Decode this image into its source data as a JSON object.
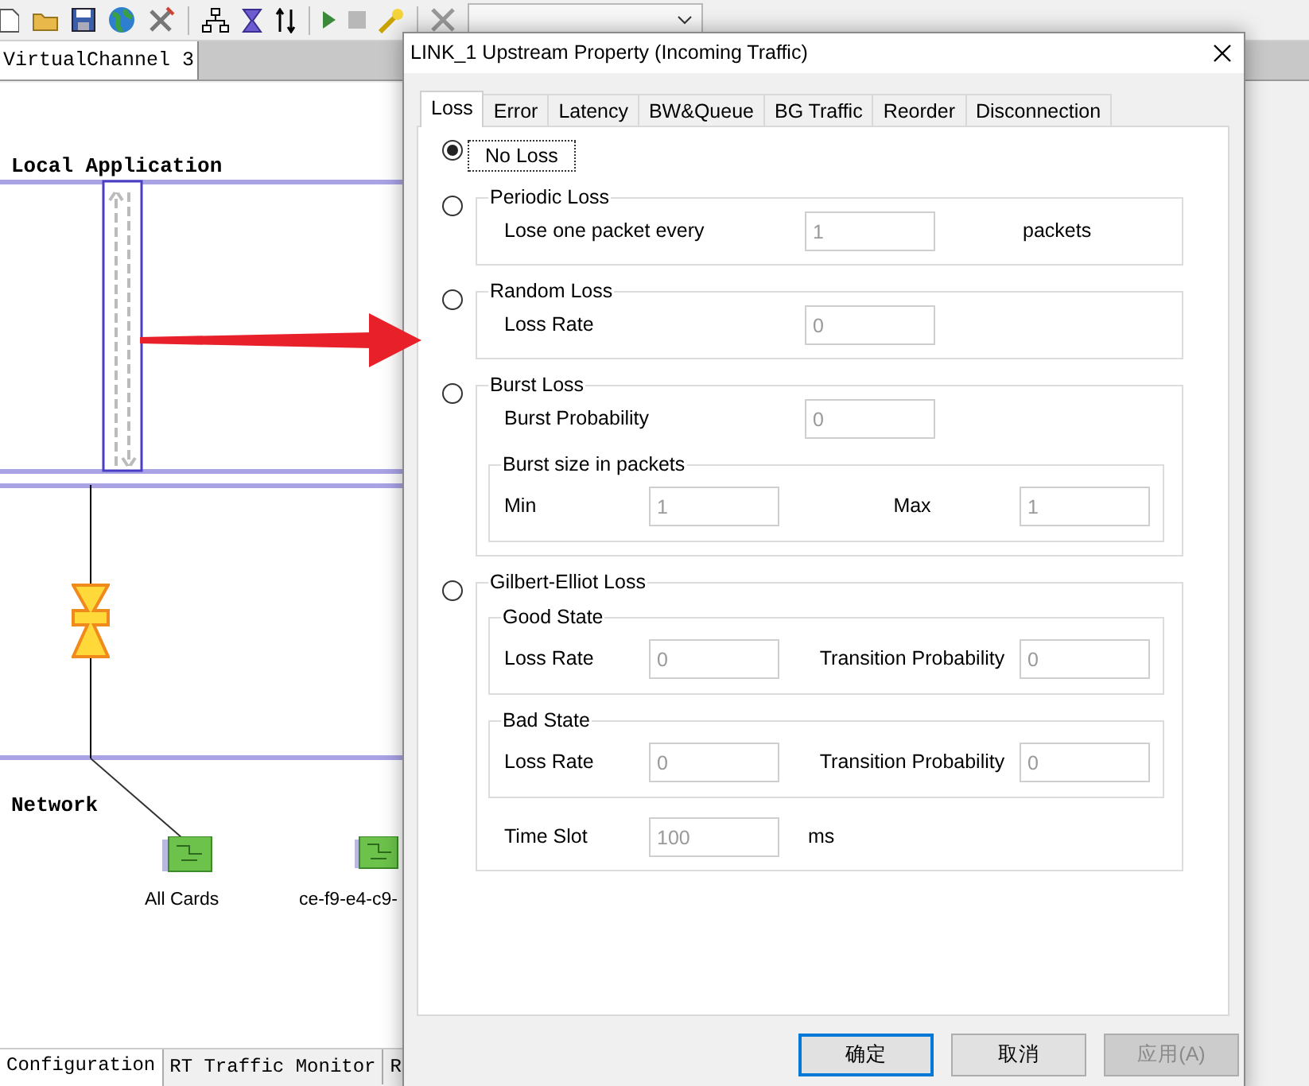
{
  "document_tabs": [
    {
      "label": "VirtualChannel 3",
      "selected": true
    }
  ],
  "diagram": {
    "sections": [
      {
        "label": "Local Application"
      },
      {
        "label": "Network"
      }
    ],
    "nodes": [
      {
        "label": "All Cards"
      },
      {
        "label": "ce-f9-e4-c9-"
      }
    ]
  },
  "bottom_tabs": [
    {
      "label": "Configuration",
      "selected": true
    },
    {
      "label": "RT Traffic Monitor",
      "selected": false
    },
    {
      "label": "R",
      "selected": false
    }
  ],
  "dialog": {
    "title": "LINK_1 Upstream Property (Incoming Traffic)",
    "tabs": [
      {
        "label": "Loss",
        "selected": true
      },
      {
        "label": "Error",
        "selected": false
      },
      {
        "label": "Latency",
        "selected": false
      },
      {
        "label": "BW&Queue",
        "selected": false
      },
      {
        "label": "BG Traffic",
        "selected": false
      },
      {
        "label": "Reorder",
        "selected": false
      },
      {
        "label": "Disconnection",
        "selected": false
      }
    ],
    "loss_options": [
      {
        "kind": "plain",
        "label": "No Loss",
        "selected": true,
        "focused": true
      },
      {
        "kind": "group",
        "label": "Periodic Loss",
        "selected": false,
        "items": [
          {
            "kind": "wide_row",
            "cells": [
              {
                "kind": "label",
                "text": "Lose one packet every"
              },
              {
                "kind": "field",
                "value": "1"
              },
              {
                "kind": "unit",
                "text": "packets"
              }
            ]
          }
        ]
      },
      {
        "kind": "group",
        "label": "Random Loss",
        "selected": false,
        "items": [
          {
            "kind": "wide_row",
            "cells": [
              {
                "kind": "label",
                "text": "Loss Rate"
              },
              {
                "kind": "field",
                "value": "0"
              }
            ]
          }
        ]
      },
      {
        "kind": "group",
        "label": "Burst Loss",
        "selected": false,
        "items": [
          {
            "kind": "wide_row",
            "cells": [
              {
                "kind": "label",
                "text": "Burst Probability"
              },
              {
                "kind": "field",
                "value": "0"
              }
            ]
          },
          {
            "kind": "subgroup",
            "title": "Burst size in packets",
            "items": [
              {
                "kind": "pair_row",
                "cells": [
                  {
                    "kind": "label",
                    "text": "Min"
                  },
                  {
                    "kind": "field",
                    "value": "1"
                  },
                  {
                    "kind": "label",
                    "text": "Max"
                  },
                  {
                    "kind": "field",
                    "value": "1"
                  }
                ]
              }
            ]
          }
        ]
      },
      {
        "kind": "group",
        "label": "Gilbert-Elliot Loss",
        "selected": false,
        "items": [
          {
            "kind": "subgroup",
            "title": "Good State",
            "items": [
              {
                "kind": "pair_row",
                "cells": [
                  {
                    "kind": "label",
                    "text": "Loss Rate"
                  },
                  {
                    "kind": "field",
                    "value": "0"
                  },
                  {
                    "kind": "label",
                    "text": "Transition Probability"
                  },
                  {
                    "kind": "field",
                    "value": "0"
                  }
                ]
              }
            ]
          },
          {
            "kind": "subgroup",
            "title": "Bad State",
            "items": [
              {
                "kind": "pair_row",
                "cells": [
                  {
                    "kind": "label",
                    "text": "Loss Rate"
                  },
                  {
                    "kind": "field",
                    "value": "0"
                  },
                  {
                    "kind": "label",
                    "text": "Transition Probability"
                  },
                  {
                    "kind": "field",
                    "value": "0"
                  }
                ]
              }
            ]
          },
          {
            "kind": "short_row",
            "cells": [
              {
                "kind": "label",
                "text": "Time Slot"
              },
              {
                "kind": "field",
                "value": "100"
              },
              {
                "kind": "unit",
                "text": "ms"
              }
            ]
          }
        ]
      }
    ],
    "buttons": [
      {
        "label": "确定",
        "default": true,
        "disabled": false
      },
      {
        "label": "取消",
        "default": false,
        "disabled": false
      },
      {
        "label": "应用(A)",
        "default": false,
        "disabled": true
      }
    ]
  }
}
